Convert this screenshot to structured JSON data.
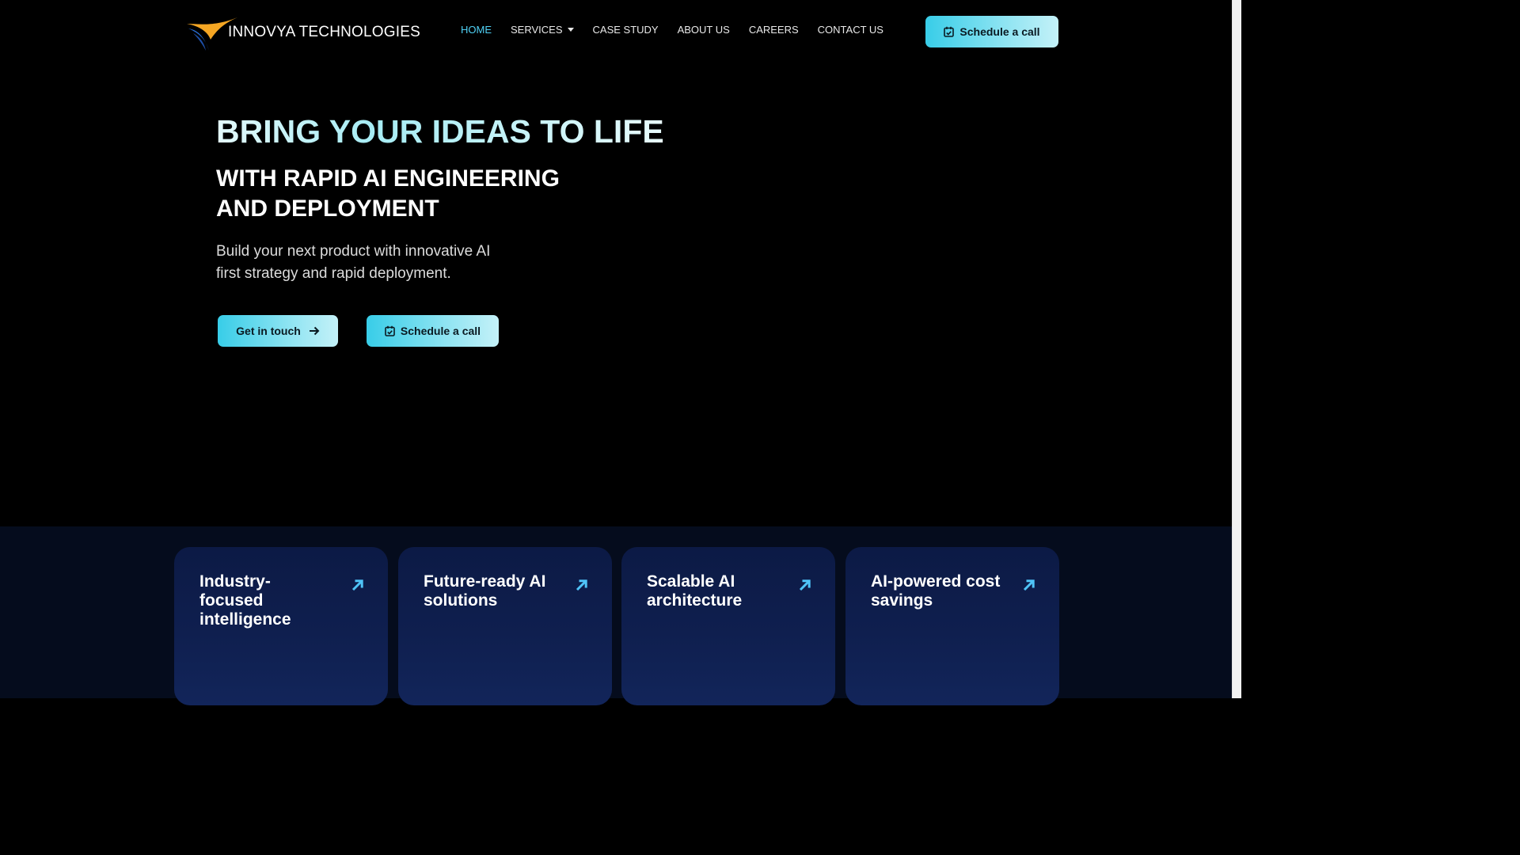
{
  "brand": {
    "name": "INNOVYA TECHNOLOGIES",
    "logo_colors": {
      "orange": "#f5a623",
      "blue": "#1f5fbf"
    }
  },
  "nav": {
    "items": [
      {
        "label": "HOME",
        "active": true
      },
      {
        "label": "SERVICES",
        "has_dropdown": true
      },
      {
        "label": "CASE STUDY"
      },
      {
        "label": "ABOUT US"
      },
      {
        "label": "CAREERS"
      },
      {
        "label": "CONTACT US"
      }
    ],
    "cta_label": "Schedule a call"
  },
  "hero": {
    "title": "BRING YOUR IDEAS TO LIFE",
    "subtitle": "WITH RAPID AI ENGINEERING AND DEPLOYMENT",
    "description": "Build your next product with innovative AI first strategy and rapid deployment.",
    "primary_button": "Get in touch",
    "secondary_button": "Schedule a call"
  },
  "features": [
    {
      "title": "Industry-focused intelligence"
    },
    {
      "title": "Future-ready AI solutions"
    },
    {
      "title": "Scalable AI architecture"
    },
    {
      "title": "AI-powered cost savings"
    }
  ],
  "colors": {
    "accent": "#4fd1f5",
    "card_bg": "#0f1f4f",
    "arrow": "#4fc3f7"
  }
}
